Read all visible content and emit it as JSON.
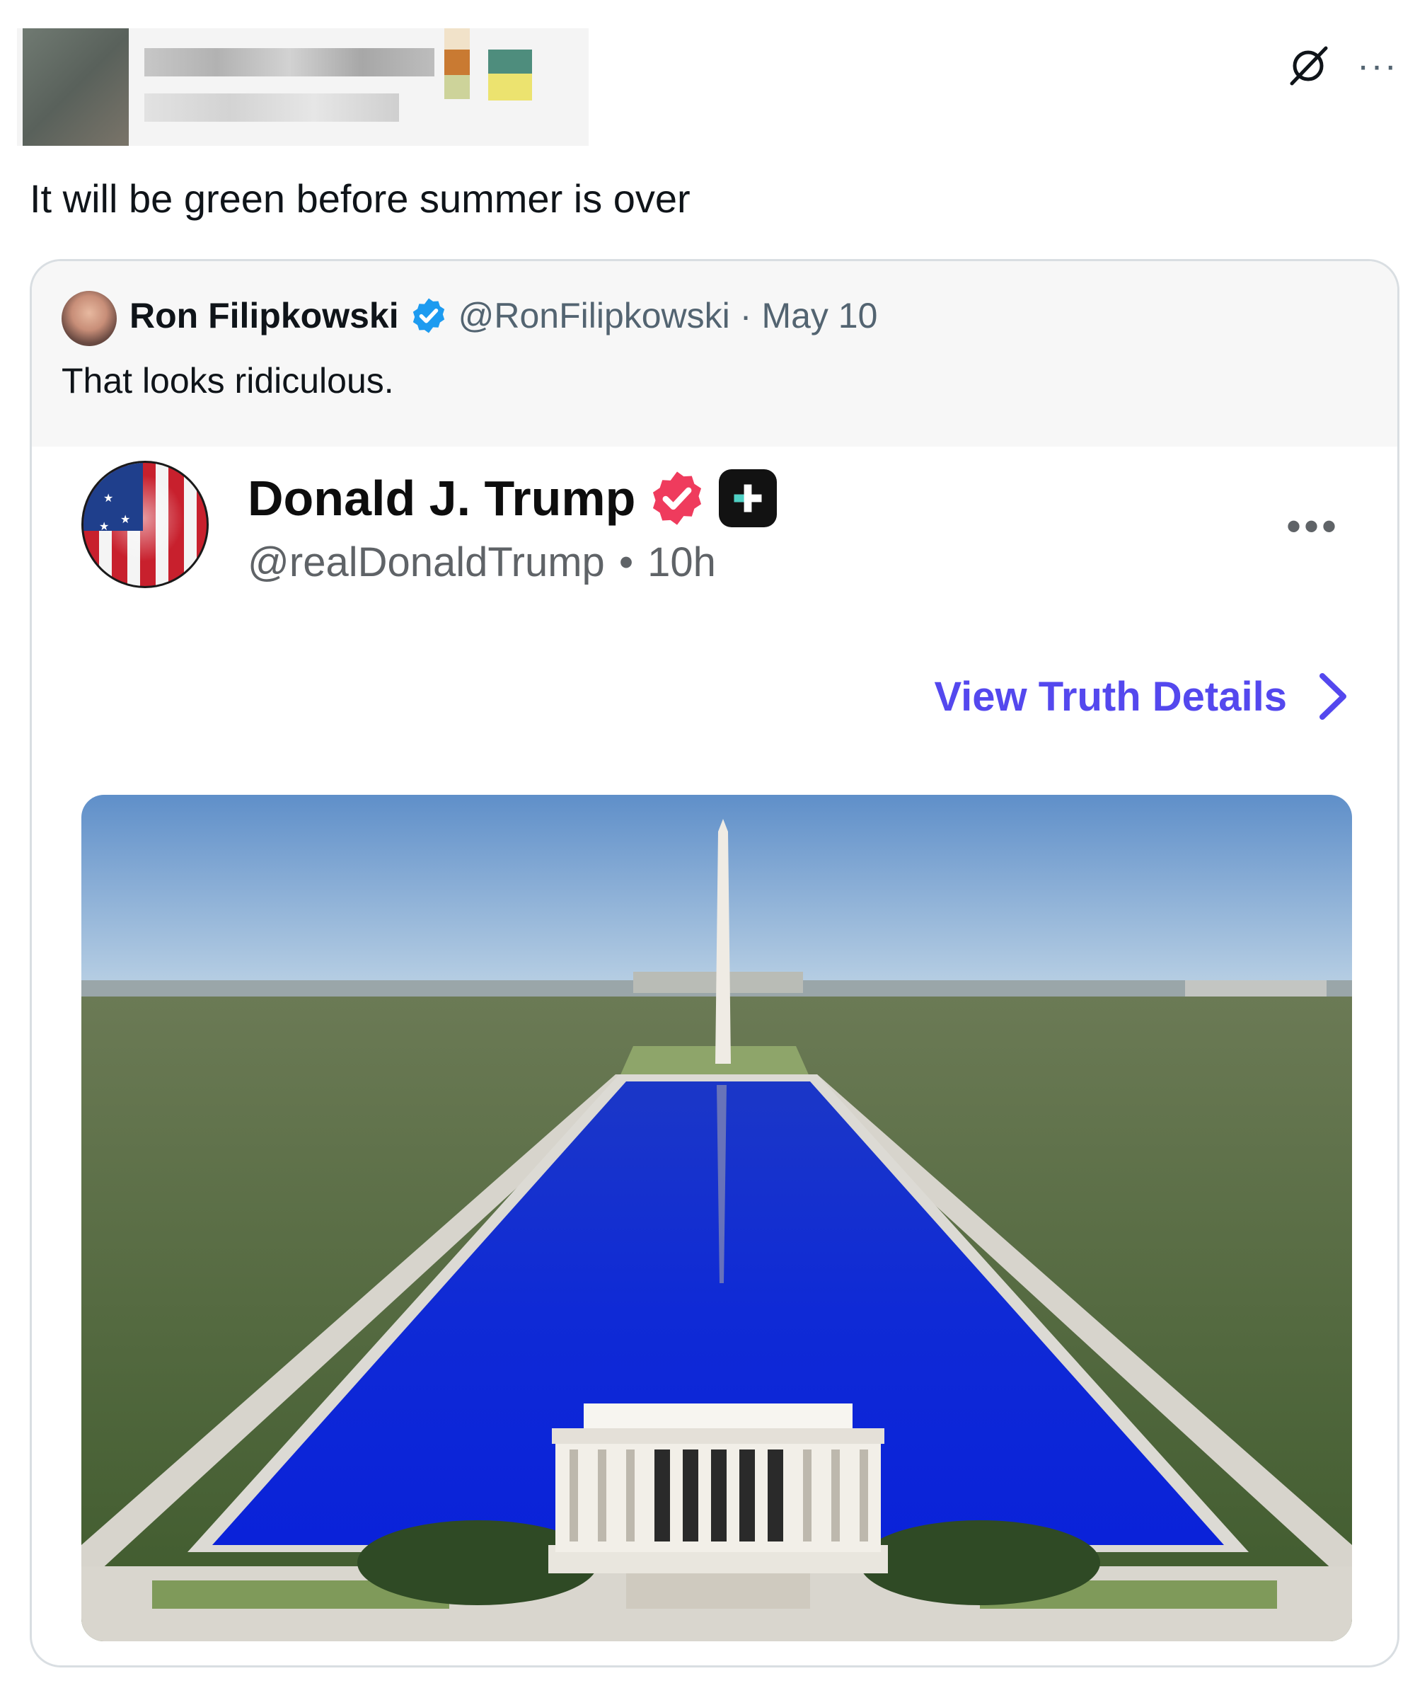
{
  "post": {
    "text": "It will be green before summer is over"
  },
  "quoted": {
    "author_name": "Ron Filipkowski",
    "handle": "@RonFilipkowski",
    "separator": "·",
    "date": "May 10",
    "text": "That looks ridiculous."
  },
  "truth": {
    "name": "Donald J. Trump",
    "handle": "@realDonaldTrump",
    "separator": "•",
    "time": "10h",
    "view_details": "View Truth Details"
  },
  "colors": {
    "verified_blue": "#1d9bf0",
    "truth_verified": "#ef3b5d",
    "truth_link": "#5448ee",
    "reflecting_pool": "#0e2bd6"
  },
  "icons": {
    "grok": "grok-icon",
    "more": "more-icon",
    "verified": "verified-badge-icon",
    "truth_plus": "truth-plus-icon",
    "chevron": "chevron-right-icon"
  }
}
